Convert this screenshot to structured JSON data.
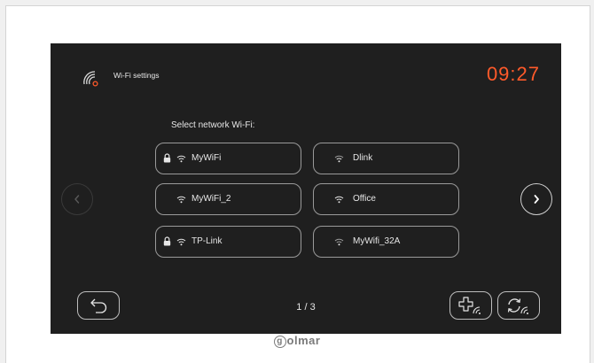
{
  "header": {
    "title": "Wi-Fi settings",
    "time": "09:27"
  },
  "prompt": "Select network Wi-Fi:",
  "networks": [
    {
      "name": "MyWiFi",
      "locked": true
    },
    {
      "name": "Dlink",
      "locked": false
    },
    {
      "name": "MyWiFi_2",
      "locked": false
    },
    {
      "name": "Office",
      "locked": false
    },
    {
      "name": "TP-Link",
      "locked": true
    },
    {
      "name": "MyWifi_32A",
      "locked": false
    }
  ],
  "pagination": {
    "label": "1 / 3"
  },
  "brand": {
    "logo_letter": "g",
    "name": "olmar"
  },
  "icons": {
    "title": "wifi-settings-icon",
    "prev": "chevron-left-icon",
    "next": "chevron-right-icon",
    "back": "back-icon",
    "add": "add-network-icon",
    "refresh": "refresh-networks-icon",
    "lock": "lock-icon",
    "signal": "wifi-signal-icon"
  },
  "colors": {
    "screen": "#1f1f1f",
    "accent": "#ff5a2a",
    "text": "#e6e6e6"
  }
}
